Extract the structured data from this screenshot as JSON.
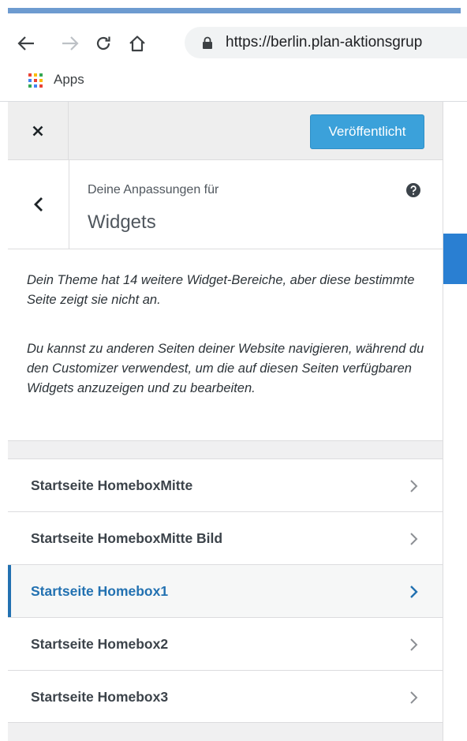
{
  "browser": {
    "url": "https://berlin.plan-aktionsgrup",
    "bookmarks": {
      "apps_label": "Apps"
    }
  },
  "customizer": {
    "publish_label": "Veröffentlicht",
    "section": {
      "kicker": "Deine Anpassungen für",
      "title": "Widgets"
    },
    "description": {
      "p1": "Dein Theme hat 14 weitere Widget-Bereiche, aber diese bestimmte Seite zeigt sie nicht an.",
      "p2": "Du kannst zu anderen Seiten deiner Website navigieren, während du den Customizer verwendest, um die auf diesen Seiten verfügbaren Widgets anzuzeigen und zu bearbeiten."
    },
    "widget_areas": [
      {
        "label": "Startseite HomeboxMitte"
      },
      {
        "label": "Startseite HomeboxMitte Bild"
      },
      {
        "label": "Startseite Homebox1"
      },
      {
        "label": "Startseite Homebox2"
      },
      {
        "label": "Startseite Homebox3"
      }
    ]
  },
  "colors": {
    "accent": "#2271b1",
    "publish_button": "#3ba1da",
    "panel_bg": "#f0f0f1"
  },
  "icons": [
    "back-arrow-icon",
    "forward-arrow-icon",
    "reload-icon",
    "home-icon",
    "lock-icon",
    "apps-grid-icon",
    "close-icon",
    "chevron-left-icon",
    "help-icon",
    "chevron-right-icon"
  ]
}
